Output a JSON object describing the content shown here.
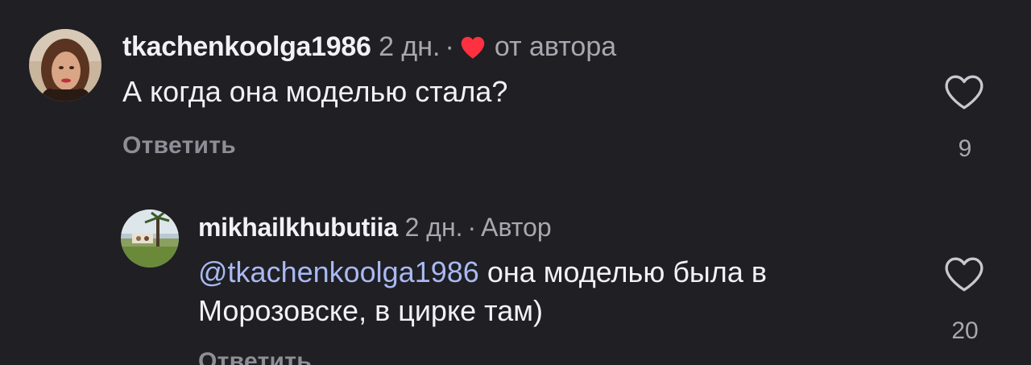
{
  "comments": [
    {
      "username": "tkachenkoolga1986",
      "time": "2 дн.",
      "separator": "·",
      "liked_by_author_label": "от автора",
      "text": "А когда она моделью стала?",
      "reply_label": "Ответить",
      "like_count": "9",
      "icons": {
        "author_like": "red-heart-icon",
        "like": "heart-outline-icon"
      },
      "colors": {
        "author_heart": "#ff3040"
      }
    },
    {
      "username": "mikhailkhubutiia",
      "time": "2 дн.",
      "separator": "·",
      "author_badge": "Автор",
      "mention": "@tkachenkoolga1986",
      "text_line1": " она моделью была в",
      "text_line2": "Морозовске,  в цирке там)",
      "reply_label": "Ответить",
      "like_count": "20",
      "icons": {
        "like": "heart-outline-icon"
      }
    }
  ],
  "colors": {
    "background": "#1f1f24",
    "mention": "#a9b9f2",
    "secondary_text": "#a8a8b0"
  }
}
